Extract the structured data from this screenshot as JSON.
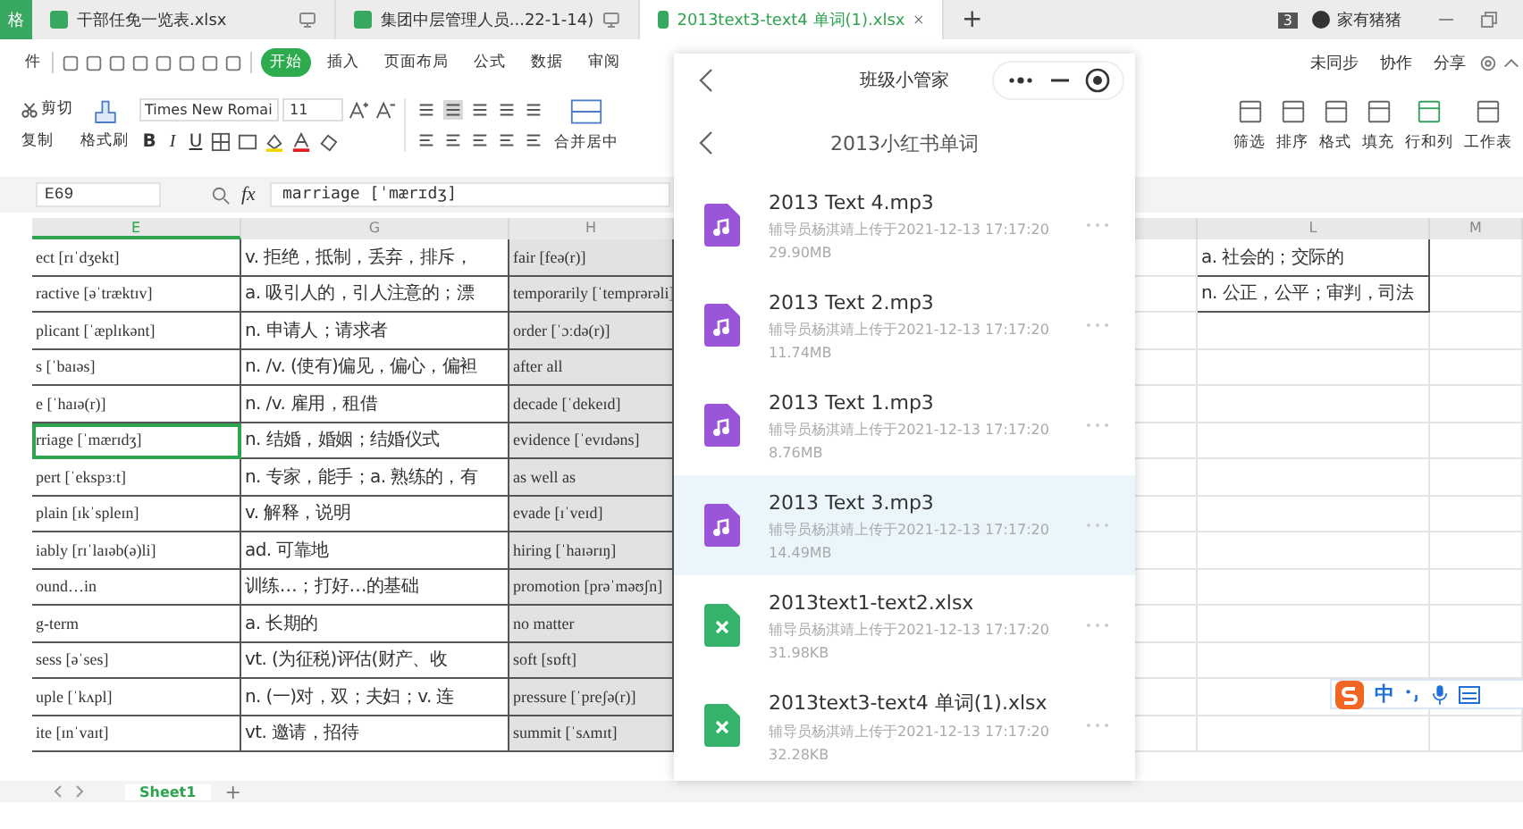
{
  "app_badge": "格",
  "tabs": [
    {
      "label": "干部任免一览表.xlsx",
      "selected": false
    },
    {
      "label": "集团中层管理人员...22-1-14)",
      "selected": false
    },
    {
      "label": "2013text3-text4 单词(1).xlsx",
      "selected": true
    }
  ],
  "new_tab": "+",
  "account": {
    "badge": "3",
    "name": "家有猪猪"
  },
  "ribbon": {
    "cut_menu": "件",
    "menus": [
      {
        "label": "开始",
        "selected": true
      },
      {
        "label": "插入",
        "selected": false
      },
      {
        "label": "页面布局",
        "selected": false
      },
      {
        "label": "公式",
        "selected": false
      },
      {
        "label": "数据",
        "selected": false
      },
      {
        "label": "审阅",
        "selected": false
      }
    ],
    "right_actions": [
      "未同步",
      "协作",
      "分享"
    ]
  },
  "toolbar": {
    "cut": "剪切",
    "copy": "复制",
    "format_painter": "格式刷",
    "font_family": "Times New Romai",
    "font_size": "11",
    "style_buttons": [
      "B",
      "I",
      "U"
    ],
    "merge": "合并居中",
    "right_tools": [
      "筛选",
      "排序",
      "格式",
      "填充",
      "行和列",
      "工作表"
    ]
  },
  "formula_bar": {
    "cell": "E69",
    "fx": "fx",
    "value": "marriage [ˈmærɪdʒ]"
  },
  "sheet": {
    "columns": [
      {
        "label": "E",
        "selected": true
      },
      {
        "label": "G",
        "selected": false
      },
      {
        "label": "H",
        "selected": false
      },
      {
        "label": "L",
        "selected": false
      },
      {
        "label": "M",
        "selected": false
      }
    ],
    "rows": [
      {
        "e": "ect [rɪˈdʒekt]",
        "g": "v. 拒绝，抵制，丢弃，排斥，",
        "h": "fair [feə(r)]",
        "l": "a. 社会的；交际的",
        "selected": false
      },
      {
        "e": "ractive [əˈtræktɪv]",
        "g": "a. 吸引人的，引人注意的；漂",
        "h": "temporarily [ˈtemprərəli]",
        "l": "n. 公正，公平；审判，司法",
        "selected": false
      },
      {
        "e": "plicant [ˈæplɪkənt]",
        "g": "n. 申请人；请求者",
        "h": "order [ˈɔːdə(r)]",
        "selected": false
      },
      {
        "e": "s [ˈbaɪəs]",
        "g": "n. /v. (使有)偏见，偏心，偏袒",
        "h": "after all",
        "selected": false
      },
      {
        "e": "e [ˈhaɪə(r)]",
        "g": "n. /v. 雇用，租借",
        "h": "decade [ˈdekeɪd]",
        "selected": false
      },
      {
        "e": "rriage [ˈmærɪdʒ]",
        "g": "n. 结婚，婚姻；结婚仪式",
        "h": "evidence [ˈevɪdəns]",
        "selected": true
      },
      {
        "e": "pert [ˈekspɜːt]",
        "g": "n. 专家，能手；a. 熟练的，有",
        "h": "as well as",
        "selected": false
      },
      {
        "e": "plain [ɪkˈspleɪn]",
        "g": "v. 解释，说明",
        "h": "evade [ɪˈveɪd]",
        "selected": false
      },
      {
        "e": "iably [rɪˈlaɪəb(ə)li]",
        "g": "ad. 可靠地",
        "h": "hiring [ˈhaɪərɪŋ]",
        "selected": false
      },
      {
        "e": "ound…in",
        "g": "训练…；打好…的基础",
        "h": "promotion [prəˈməʊʃn]",
        "selected": false
      },
      {
        "e": "g-term",
        "g": "a. 长期的",
        "h": "no matter",
        "selected": false
      },
      {
        "e": "sess [əˈses]",
        "g": "vt. (为征税)评估(财产、收",
        "h": "soft [sɒft]",
        "selected": false
      },
      {
        "e": "uple [ˈkʌpl]",
        "g": "n. (一)对，双；夫妇；v. 连",
        "h": "pressure [ˈpreʃə(r)]",
        "selected": false
      },
      {
        "e": "ite [ɪnˈvaɪt]",
        "g": "vt. 邀请，招待",
        "h": "summit [ˈsʌmɪt]",
        "selected": false
      }
    ],
    "sheet_tabs": [
      {
        "label": "Sheet1",
        "selected": true
      }
    ],
    "add_sheet": "+"
  },
  "panel": {
    "title": "班级小管家",
    "folder": "2013小红书单词",
    "files": [
      {
        "name": "2013 Text 4.mp3",
        "meta": "辅导员杨淇靖上传于2021-12-13 17:17:20",
        "size": "29.90MB",
        "kind": "audio",
        "selected": false
      },
      {
        "name": "2013 Text 2.mp3",
        "meta": "辅导员杨淇靖上传于2021-12-13 17:17:20",
        "size": "11.74MB",
        "kind": "audio",
        "selected": false
      },
      {
        "name": "2013 Text 1.mp3",
        "meta": "辅导员杨淇靖上传于2021-12-13 17:17:20",
        "size": "8.76MB",
        "kind": "audio",
        "selected": false
      },
      {
        "name": "2013 Text 3.mp3",
        "meta": "辅导员杨淇靖上传于2021-12-13 17:17:20",
        "size": "14.49MB",
        "kind": "audio",
        "selected": true
      },
      {
        "name": "2013text1-text2.xlsx",
        "meta": "辅导员杨淇靖上传于2021-12-13 17:17:20",
        "size": "31.98KB",
        "kind": "sheet",
        "selected": false
      },
      {
        "name": "2013text3-text4 单词(1).xlsx",
        "meta": "辅导员杨淇靖上传于2021-12-13 17:17:20",
        "size": "32.28KB",
        "kind": "sheet",
        "selected": false
      }
    ]
  },
  "ime": {
    "label": "中"
  }
}
